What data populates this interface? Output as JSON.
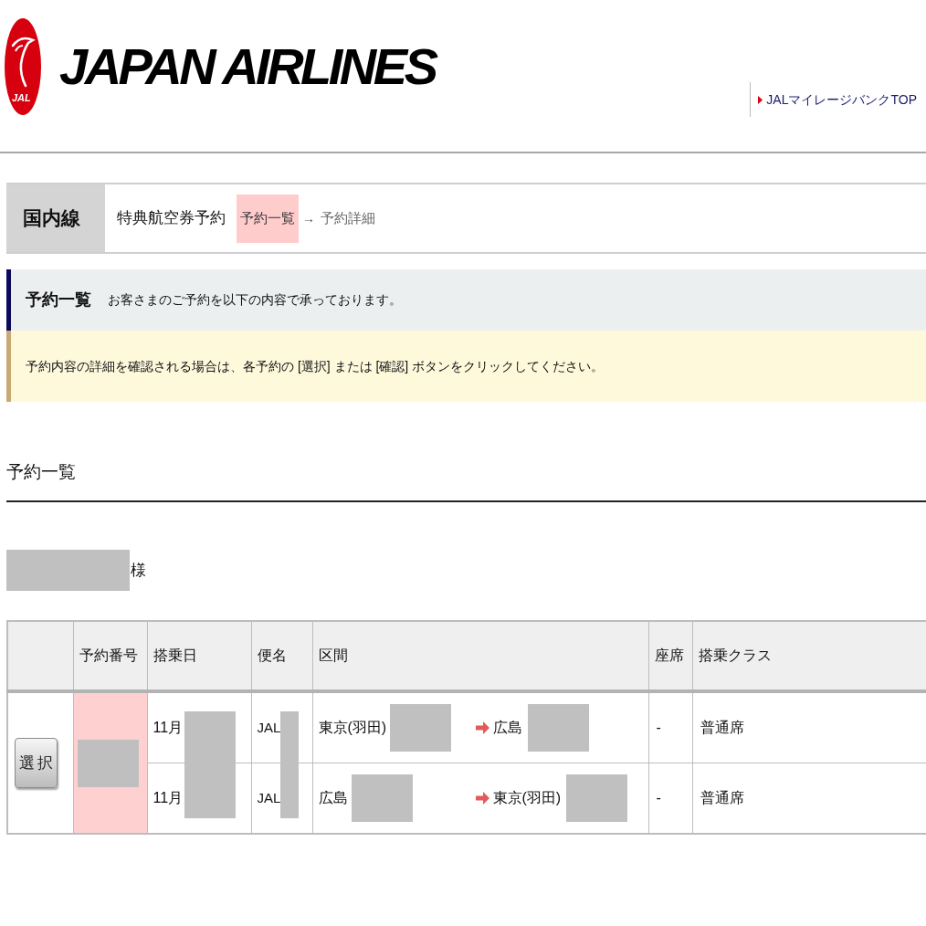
{
  "header": {
    "logo_mark": "JAL",
    "wordmark": "JAPAN AIRLINES",
    "link": "JALマイレージバンクTOP"
  },
  "breadcrumb": {
    "category": "国内線",
    "title": "特典航空券予約",
    "steps": [
      {
        "label": "予約一覧",
        "selected": true
      },
      {
        "label": "予約詳細",
        "selected": false
      }
    ],
    "separator": "→"
  },
  "notice": {
    "title": "予約一覧",
    "message": "お客さまのご予約を以下の内容で承っております。",
    "instruction": "予約内容の詳細を確認される場合は、各予約の [選択] または [確認] ボタンをクリックしてください。"
  },
  "section_title": "予約一覧",
  "customer": {
    "name_redacted": true,
    "honorific": "様"
  },
  "table": {
    "columns": [
      "予約番号",
      "搭乗日",
      "便名",
      "区間",
      "座席",
      "搭乗クラス"
    ],
    "reservations": [
      {
        "button": "選択",
        "number_redacted": true,
        "flights": [
          {
            "date": "11月",
            "date_redacted": true,
            "flight": "JAL",
            "flight_redacted": true,
            "origin": "東京(羽田)",
            "origin_redacted": true,
            "destination": "広島",
            "destination_redacted": true,
            "seat": "-",
            "class": "普通席"
          },
          {
            "date": "11月",
            "date_redacted": true,
            "flight": "JAL",
            "flight_redacted": true,
            "origin": "広島",
            "origin_redacted": true,
            "destination": "東京(羽田)",
            "destination_redacted": true,
            "seat": "-",
            "class": "普通席"
          }
        ]
      }
    ]
  }
}
